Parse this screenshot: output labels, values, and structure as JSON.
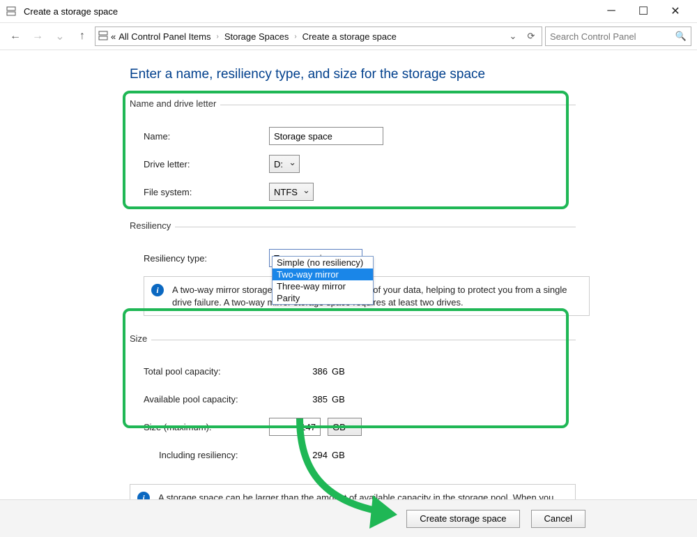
{
  "window": {
    "title": "Create a storage space"
  },
  "breadcrumb": {
    "prefix": "«",
    "c1": "All Control Panel Items",
    "c2": "Storage Spaces",
    "c3": "Create a storage space"
  },
  "search": {
    "placeholder": "Search Control Panel"
  },
  "heading": "Enter a name, resiliency type, and size for the storage space",
  "section_name": {
    "legend": "Name and drive letter",
    "name_label": "Name:",
    "name_value": "Storage space",
    "drive_label": "Drive letter:",
    "drive_value": "D:",
    "fs_label": "File system:",
    "fs_value": "NTFS"
  },
  "section_resil": {
    "legend": "Resiliency",
    "type_label": "Resiliency type:",
    "type_selected": "Two-way mirror",
    "options": {
      "o0": "Simple (no resiliency)",
      "o1": "Two-way mirror",
      "o2": "Three-way mirror",
      "o3": "Parity"
    },
    "info": "A two-way mirror storage space writes two copies of your data, helping to protect you from a single drive failure. A two-way mirror storage space requires at least two drives."
  },
  "section_size": {
    "legend": "Size",
    "total_label": "Total pool capacity:",
    "total_val": "386",
    "total_unit": "GB",
    "avail_label": "Available pool capacity:",
    "avail_val": "385",
    "avail_unit": "GB",
    "max_label": "Size (maximum):",
    "max_val": "147",
    "max_unit": "GB",
    "incl_label": "Including resiliency:",
    "incl_val": "294",
    "incl_unit": "GB"
  },
  "info2": "A storage space can be larger than the amount of available capacity in the storage pool. When you run low on capacity in the pool, you can add more drives.",
  "buttons": {
    "create": "Create storage space",
    "cancel": "Cancel"
  },
  "colors": {
    "accent": "#1fb755"
  }
}
